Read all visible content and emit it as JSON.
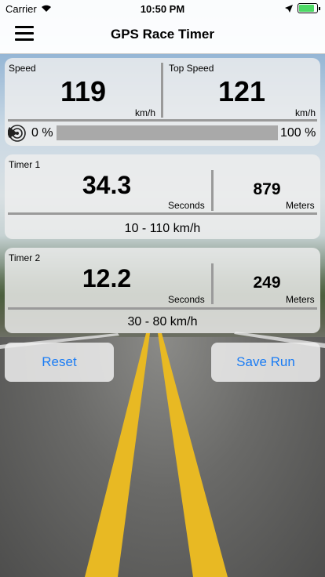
{
  "status_bar": {
    "carrier": "Carrier",
    "time": "10:50 PM"
  },
  "nav": {
    "title": "GPS Race Timer",
    "menu_icon": "hamburger-menu-icon"
  },
  "speed_panel": {
    "speed_label": "Speed",
    "speed_value": "119",
    "speed_unit": "km/h",
    "top_speed_label": "Top Speed",
    "top_speed_value": "121",
    "top_speed_unit": "km/h",
    "gps_icon": "radar-icon",
    "signal_min": "0 %",
    "signal_max": "100 %"
  },
  "timer1": {
    "label": "Timer 1",
    "time_value": "34.3",
    "time_unit": "Seconds",
    "distance_value": "879",
    "distance_unit": "Meters",
    "range": "10 - 110 km/h"
  },
  "timer2": {
    "label": "Timer 2",
    "time_value": "12.2",
    "time_unit": "Seconds",
    "distance_value": "249",
    "distance_unit": "Meters",
    "range": "30 - 80 km/h"
  },
  "buttons": {
    "reset": "Reset",
    "save_run": "Save Run"
  },
  "colors": {
    "accent": "#1a7cf4",
    "battery": "#4cd964",
    "road_line": "#e8b923"
  }
}
